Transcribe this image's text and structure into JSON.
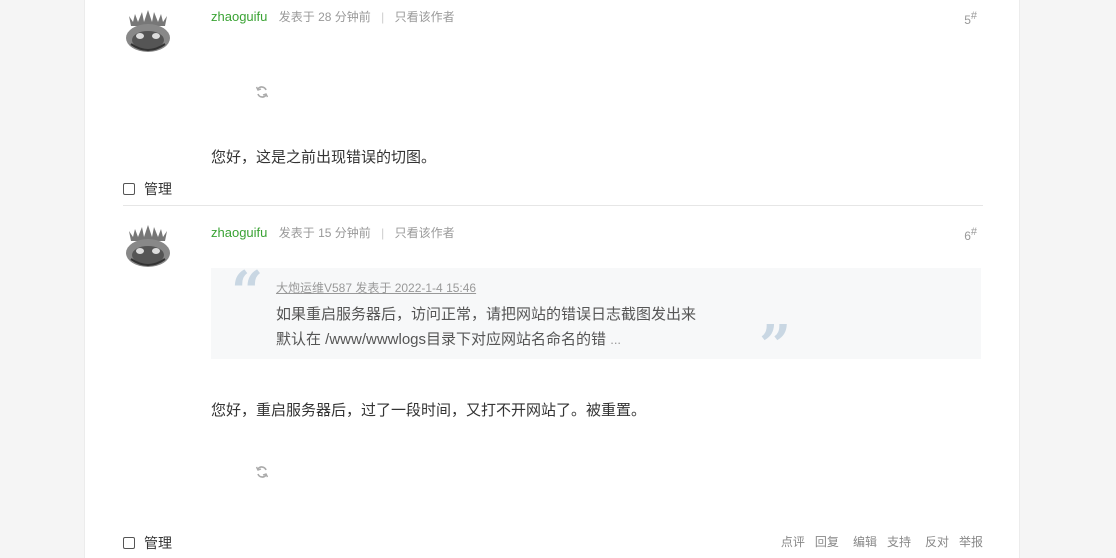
{
  "posts": [
    {
      "author": "zhaoguifu",
      "posted": "发表于 28 分钟前",
      "only_author": "只看该作者",
      "floor_num": "5",
      "floor_mark": "#",
      "content": "您好，这是之前出现错误的切图。",
      "manage_label": "管理"
    },
    {
      "author": "zhaoguifu",
      "posted": "发表于 15 分钟前",
      "only_author": "只看该作者",
      "floor_num": "6",
      "floor_mark": "#",
      "quote": {
        "source": "大炮运维V587 发表于 2022-1-4 15:46",
        "line1": "如果重启服务器后，访问正常，请把网站的错误日志截图发出来",
        "line2": "默认在 /www/wwwlogs目录下对应网站名命名的错",
        "ellipsis": "..."
      },
      "content": "您好，重启服务器后，过了一段时间，又打不开网站了。被重置。",
      "manage_label": "管理",
      "actions": [
        "点评",
        "回复",
        "编辑",
        "支持",
        "反对",
        "举报"
      ]
    }
  ],
  "icons": {
    "avatar": "avatar-icon",
    "refresh": "refresh-icon",
    "checkbox": "checkbox-icon"
  },
  "colors": {
    "author": "#3aa334",
    "meta": "#999999",
    "quote_bg": "#f7f8f9",
    "quote_mark": "#c9d7e3"
  }
}
